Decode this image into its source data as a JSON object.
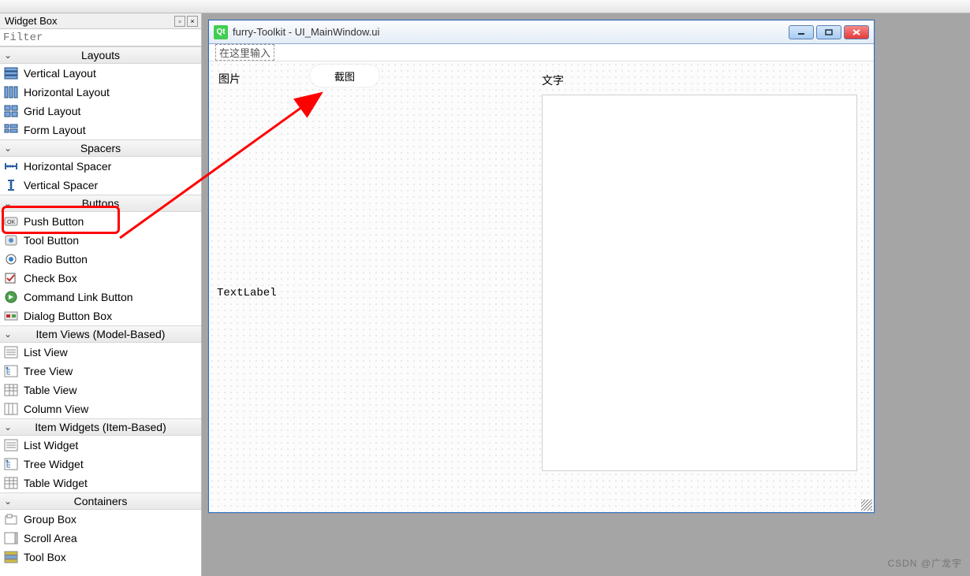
{
  "dock": {
    "title": "Widget Box",
    "filter_placeholder": "Filter"
  },
  "categories": [
    {
      "name": "Layouts",
      "items": [
        {
          "label": "Vertical Layout",
          "icon": "vlayout"
        },
        {
          "label": "Horizontal Layout",
          "icon": "hlayout"
        },
        {
          "label": "Grid Layout",
          "icon": "gridlayout"
        },
        {
          "label": "Form Layout",
          "icon": "formlayout"
        }
      ]
    },
    {
      "name": "Spacers",
      "items": [
        {
          "label": "Horizontal Spacer",
          "icon": "hspacer"
        },
        {
          "label": "Vertical Spacer",
          "icon": "vspacer"
        }
      ]
    },
    {
      "name": "Buttons",
      "items": [
        {
          "label": "Push Button",
          "icon": "pushbutton"
        },
        {
          "label": "Tool Button",
          "icon": "toolbutton"
        },
        {
          "label": "Radio Button",
          "icon": "radiobutton"
        },
        {
          "label": "Check Box",
          "icon": "checkbox"
        },
        {
          "label": "Command Link Button",
          "icon": "cmdlink"
        },
        {
          "label": "Dialog Button Box",
          "icon": "dialogbox"
        }
      ]
    },
    {
      "name": "Item Views (Model-Based)",
      "items": [
        {
          "label": "List View",
          "icon": "listview"
        },
        {
          "label": "Tree View",
          "icon": "treeview"
        },
        {
          "label": "Table View",
          "icon": "tableview"
        },
        {
          "label": "Column View",
          "icon": "columnview"
        }
      ]
    },
    {
      "name": "Item Widgets (Item-Based)",
      "items": [
        {
          "label": "List Widget",
          "icon": "listview"
        },
        {
          "label": "Tree Widget",
          "icon": "treeview"
        },
        {
          "label": "Table Widget",
          "icon": "tableview"
        }
      ]
    },
    {
      "name": "Containers",
      "items": [
        {
          "label": "Group Box",
          "icon": "groupbox"
        },
        {
          "label": "Scroll Area",
          "icon": "scrollarea"
        },
        {
          "label": "Tool Box",
          "icon": "toolbox"
        }
      ]
    }
  ],
  "form_window": {
    "title": "furry-Toolkit - UI_MainWindow.ui",
    "menu_hint": "在这里输入",
    "labels": {
      "image": "图片",
      "text": "文字",
      "textlabel": "TextLabel"
    },
    "buttons": {
      "screenshot": "截图"
    }
  },
  "watermark": "CSDN @广龙宇"
}
